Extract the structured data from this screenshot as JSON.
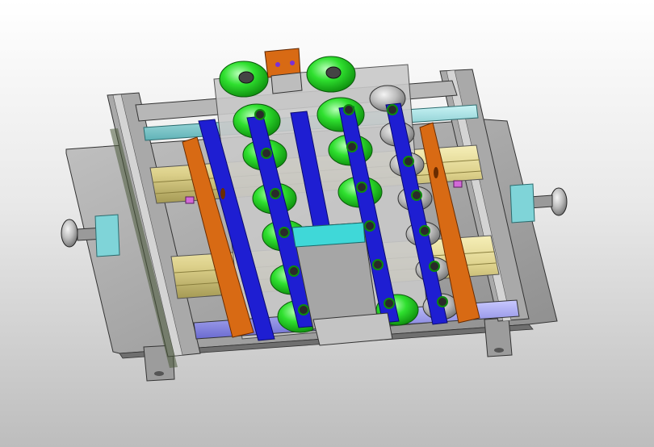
{
  "viewport": {
    "background_top": "#ffffff",
    "background_bottom": "#bdbdbd"
  },
  "model": {
    "description_colors": {
      "base_plate": "#a9a9a9",
      "frame_rail": "#9a9a9a",
      "linear_guide": "#dcd08a",
      "belt": "#1e1ed2",
      "side_guide": "#d86a14",
      "wheel_green": "#1fd11f",
      "wheel_gray": "#b8b8b8",
      "shaft": "#7fd4d8",
      "roller": "#8b8be6",
      "center_cover": "#a6a6a6",
      "center_cover_top": "#3fd8d8",
      "motor_block": "#d86a14"
    },
    "icons": [
      "pulley-wheel-icon",
      "belt-conveyor-icon",
      "linear-rail-icon",
      "hand-knob-icon"
    ]
  }
}
